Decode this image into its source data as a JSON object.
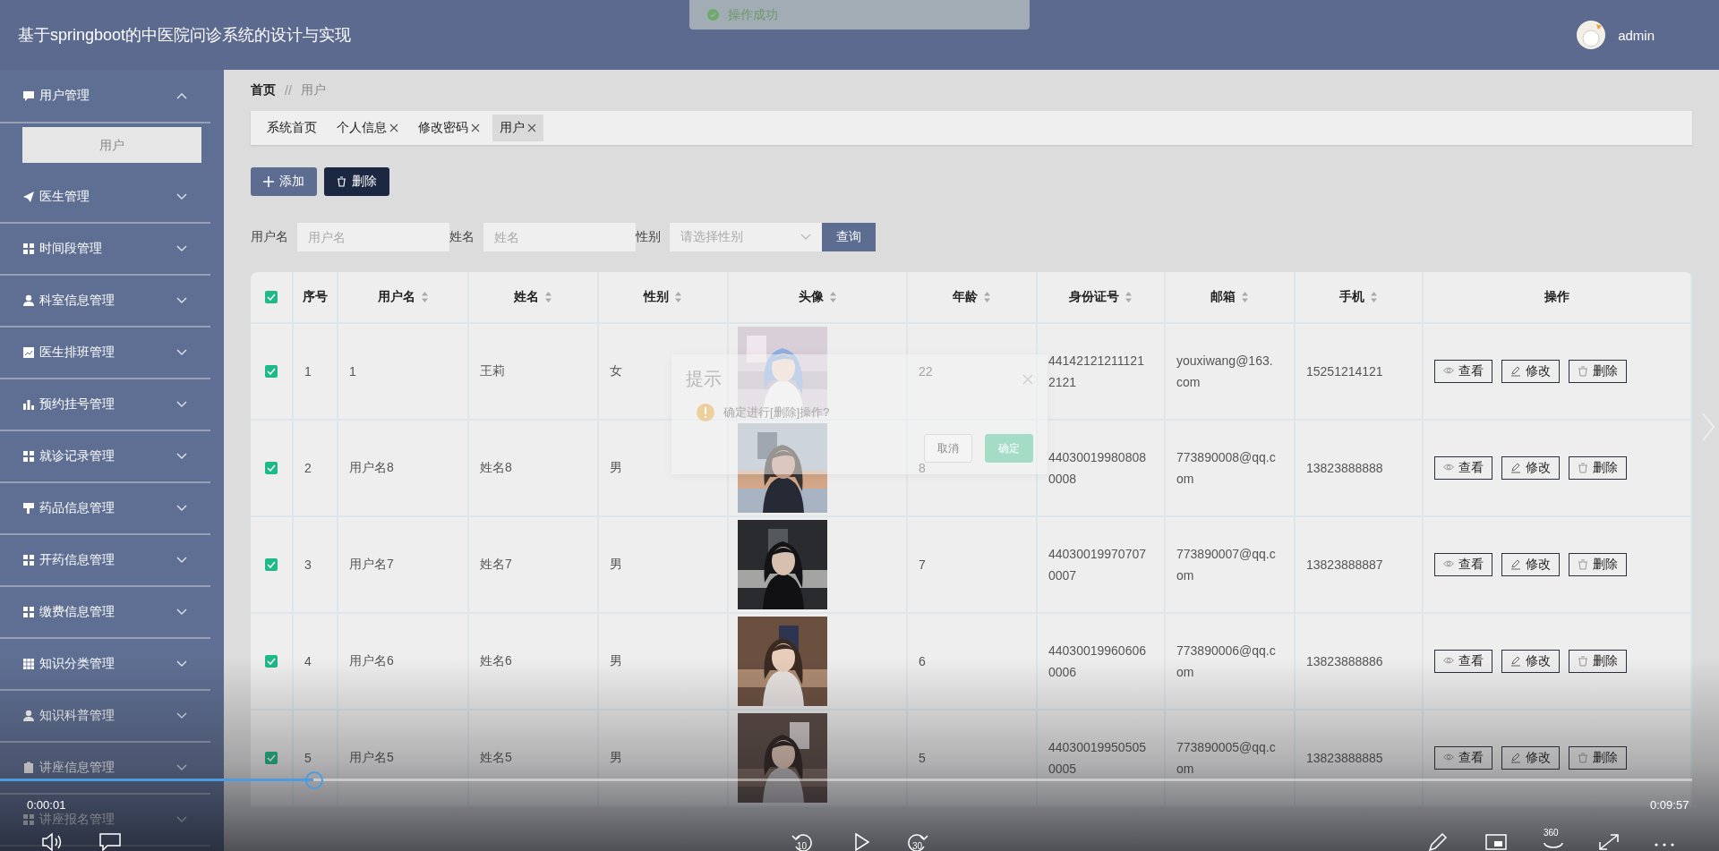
{
  "header": {
    "title": "基于springboot的中医院问诊系统的设计与实现",
    "user": "admin"
  },
  "toast": {
    "text": "操作成功"
  },
  "sidebar": {
    "items": [
      {
        "label": "用户管理",
        "expanded": true,
        "children": [
          {
            "label": "用户",
            "selected": true
          }
        ]
      },
      {
        "label": "医生管理",
        "expanded": false
      },
      {
        "label": "时间段管理",
        "expanded": false
      },
      {
        "label": "科室信息管理",
        "expanded": false
      },
      {
        "label": "医生排班管理",
        "expanded": false
      },
      {
        "label": "预约挂号管理",
        "expanded": false
      },
      {
        "label": "就诊记录管理",
        "expanded": false
      },
      {
        "label": "药品信息管理",
        "expanded": false
      },
      {
        "label": "开药信息管理",
        "expanded": false
      },
      {
        "label": "缴费信息管理",
        "expanded": false
      },
      {
        "label": "知识分类管理",
        "expanded": false
      },
      {
        "label": "知识科普管理",
        "expanded": false
      },
      {
        "label": "讲座信息管理",
        "expanded": false
      },
      {
        "label": "讲座报名管理",
        "expanded": false
      }
    ]
  },
  "breadcrumb": {
    "items": [
      "首页",
      "用户"
    ],
    "separator": "//"
  },
  "tabs": [
    {
      "label": "系统首页",
      "closable": false,
      "selected": false
    },
    {
      "label": "个人信息",
      "closable": true,
      "selected": false
    },
    {
      "label": "修改密码",
      "closable": true,
      "selected": false
    },
    {
      "label": "用户",
      "closable": true,
      "selected": true
    }
  ],
  "toolbar": {
    "buttons": [
      {
        "label": "添加",
        "kind": "add"
      },
      {
        "label": "删除",
        "kind": "delete"
      }
    ]
  },
  "filters": {
    "fields": [
      {
        "label": "用户名",
        "placeholder": "用户名",
        "kind": "input"
      },
      {
        "label": "姓名",
        "placeholder": "姓名",
        "kind": "input"
      },
      {
        "label": "性别",
        "placeholder": "请选择性别",
        "kind": "select"
      }
    ],
    "search_button": "查询"
  },
  "table": {
    "all_checked": true,
    "columns": [
      {
        "label": "序号",
        "sortable": false
      },
      {
        "label": "用户名",
        "sortable": true
      },
      {
        "label": "姓名",
        "sortable": true
      },
      {
        "label": "性别",
        "sortable": true
      },
      {
        "label": "头像",
        "sortable": true
      },
      {
        "label": "年龄",
        "sortable": true
      },
      {
        "label": "身份证号",
        "sortable": true
      },
      {
        "label": "邮箱",
        "sortable": true
      },
      {
        "label": "手机",
        "sortable": true
      },
      {
        "label": "操作",
        "sortable": false
      }
    ],
    "rows": [
      {
        "checked": true,
        "index": "1",
        "username": "1",
        "name": "王莉",
        "gender": "女",
        "avatar": {
          "kind": "picture"
        },
        "age": "22",
        "id_number": "441421212111212121",
        "email": "youxiwang@163.com",
        "phone": "15251214121",
        "actions": [
          "查看",
          "修改",
          "删除"
        ]
      },
      {
        "checked": true,
        "index": "2",
        "username": "用户名8",
        "name": "姓名8",
        "gender": "男",
        "avatar": {
          "kind": "picture"
        },
        "age": "8",
        "id_number": "440300199808080008",
        "email": "773890008@qq.com",
        "phone": "13823888888",
        "actions": [
          "查看",
          "修改",
          "删除"
        ]
      },
      {
        "checked": true,
        "index": "3",
        "username": "用户名7",
        "name": "姓名7",
        "gender": "男",
        "avatar": {
          "kind": "picture"
        },
        "age": "7",
        "id_number": "440300199707070007",
        "email": "773890007@qq.com",
        "phone": "13823888887",
        "actions": [
          "查看",
          "修改",
          "删除"
        ]
      },
      {
        "checked": true,
        "index": "4",
        "username": "用户名6",
        "name": "姓名6",
        "gender": "男",
        "avatar": {
          "kind": "picture"
        },
        "age": "6",
        "id_number": "440300199606060006",
        "email": "773890006@qq.com",
        "phone": "13823888886",
        "actions": [
          "查看",
          "修改",
          "删除"
        ]
      },
      {
        "checked": true,
        "index": "5",
        "username": "用户名5",
        "name": "姓名5",
        "gender": "男",
        "avatar": {
          "kind": "picture"
        },
        "age": "5",
        "id_number": "440300199505050005",
        "email": "773890005@qq.com",
        "phone": "13823888885",
        "actions": [
          "查看",
          "修改",
          "删除"
        ]
      }
    ]
  },
  "dialog": {
    "title": "提示",
    "message": "确定进行[删除]操作?",
    "buttons": [
      {
        "label": "取消",
        "kind": "cancel"
      },
      {
        "label": "确定",
        "kind": "confirm"
      }
    ]
  },
  "player": {
    "elapsed": "0:00:01",
    "duration": "0:09:57",
    "level": 0.185,
    "rewind_label": "10",
    "forward_label": "30",
    "view_label": "360"
  }
}
